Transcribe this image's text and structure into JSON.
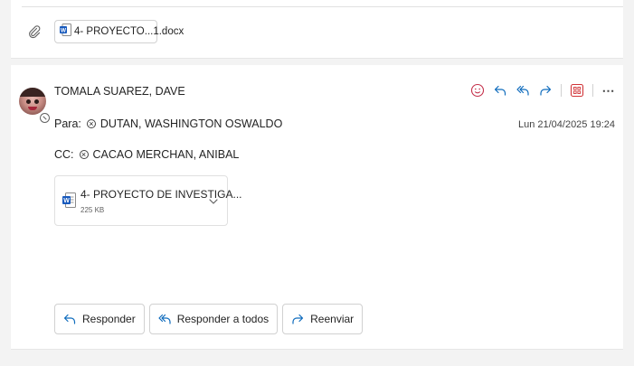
{
  "top_attachment": {
    "name": "4- PROYECTO...1.docx",
    "icon": "word-doc-icon"
  },
  "message": {
    "sender": "TOMALA SUAREZ, DAVE",
    "to_label": "Para:",
    "to_name": "DUTAN, WASHINGTON OSWALDO",
    "cc_label": "CC:",
    "cc_name": "CACAO MERCHAN, ANIBAL",
    "timestamp": "Lun 21/04/2025 19:24",
    "attachment": {
      "name": "4- PROYECTO DE INVESTIGA...",
      "size": "225 KB"
    }
  },
  "reply_buttons": {
    "reply": "Responder",
    "reply_all": "Responder a todos",
    "forward": "Reenviar"
  },
  "colors": {
    "accent": "#0f6cbd",
    "emoji": "#c4314b",
    "apps": "#d13438",
    "word": "#185abd"
  }
}
